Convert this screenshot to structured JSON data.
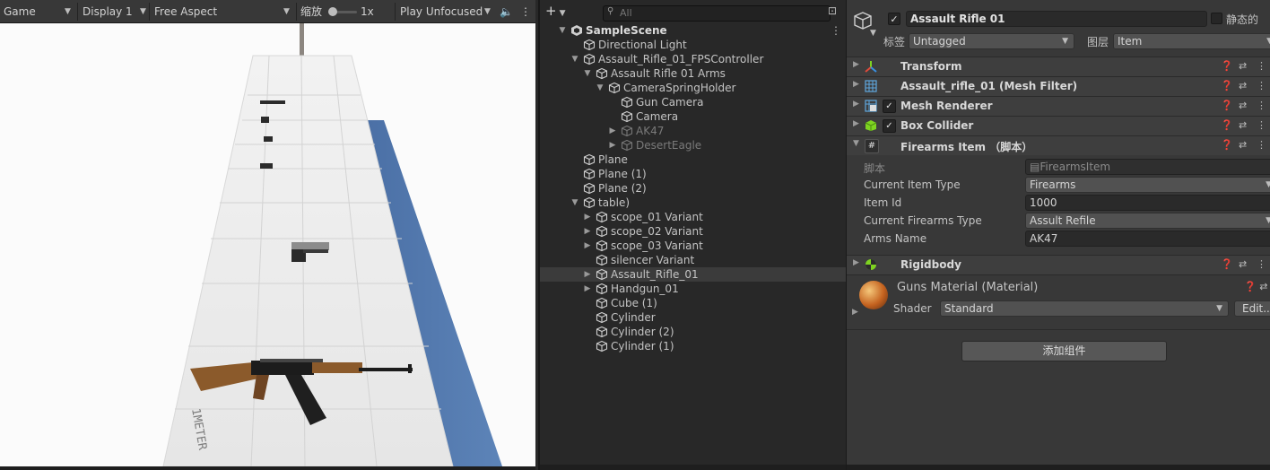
{
  "game": {
    "tab_label": "Game",
    "display": "Display 1",
    "aspect": "Free Aspect",
    "scale_label": "缩放",
    "scale_value": "1x",
    "play_mode": "Play Unfocused",
    "ruler_text": "1METER"
  },
  "hierarchy": {
    "search_placeholder": "All",
    "rows": [
      {
        "label": "SampleScene",
        "depth": 0,
        "fold": "open",
        "scene": true
      },
      {
        "label": "Directional Light",
        "depth": 1,
        "fold": "none"
      },
      {
        "label": "Assault_Rifle_01_FPSController",
        "depth": 1,
        "fold": "open"
      },
      {
        "label": "Assault Rifle 01 Arms",
        "depth": 2,
        "fold": "open"
      },
      {
        "label": "CameraSpringHolder",
        "depth": 3,
        "fold": "open"
      },
      {
        "label": "Gun Camera",
        "depth": 4,
        "fold": "none"
      },
      {
        "label": "Camera",
        "depth": 4,
        "fold": "none"
      },
      {
        "label": "AK47",
        "depth": 4,
        "fold": "closed",
        "disabled": true
      },
      {
        "label": "DesertEagle",
        "depth": 4,
        "fold": "closed",
        "disabled": true
      },
      {
        "label": "Plane",
        "depth": 1,
        "fold": "none"
      },
      {
        "label": "Plane (1)",
        "depth": 1,
        "fold": "none"
      },
      {
        "label": "Plane (2)",
        "depth": 1,
        "fold": "none"
      },
      {
        "label": "table)",
        "depth": 1,
        "fold": "open"
      },
      {
        "label": "scope_01 Variant",
        "depth": 2,
        "fold": "closed"
      },
      {
        "label": "scope_02 Variant",
        "depth": 2,
        "fold": "closed"
      },
      {
        "label": "scope_03 Variant",
        "depth": 2,
        "fold": "closed"
      },
      {
        "label": "silencer Variant",
        "depth": 2,
        "fold": "none"
      },
      {
        "label": "Assault_Rifle_01",
        "depth": 2,
        "fold": "closed",
        "selected": true
      },
      {
        "label": "Handgun_01",
        "depth": 2,
        "fold": "closed"
      },
      {
        "label": "Cube (1)",
        "depth": 2,
        "fold": "none"
      },
      {
        "label": "Cylinder",
        "depth": 2,
        "fold": "none"
      },
      {
        "label": "Cylinder (2)",
        "depth": 2,
        "fold": "none"
      },
      {
        "label": "Cylinder (1)",
        "depth": 2,
        "fold": "none"
      }
    ]
  },
  "inspector": {
    "object_name": "Assault Rifle 01",
    "static_label": "静态的",
    "tag_label": "标签",
    "tag_value": "Untagged",
    "layer_label": "图层",
    "layer_value": "Item",
    "components": {
      "transform": "Transform",
      "mesh_filter": "Assault_rifle_01 (Mesh Filter)",
      "mesh_renderer": "Mesh Renderer",
      "box_collider": "Box Collider",
      "firearms_item": "Firearms Item （脚本）",
      "rigidbody": "Rigidbody"
    },
    "script_props": {
      "script_label": "脚本",
      "script_value": "FirearmsItem",
      "item_type_label": "Current Item Type",
      "item_type_value": "Firearms",
      "item_id_label": "Item Id",
      "item_id_value": "1000",
      "firearms_type_label": "Current Firearms Type",
      "firearms_type_value": "Assult Refile",
      "arms_name_label": "Arms Name",
      "arms_name_value": "AK47"
    },
    "material": {
      "name": "Guns Material (Material)",
      "shader_label": "Shader",
      "shader_value": "Standard",
      "edit_label": "Edit..."
    },
    "add_component": "添加组件"
  },
  "colors": {
    "selection": "#3b3b3b",
    "panel": "#383838",
    "field": "#2a2a2a",
    "table_wall": "#4a6fa5"
  }
}
